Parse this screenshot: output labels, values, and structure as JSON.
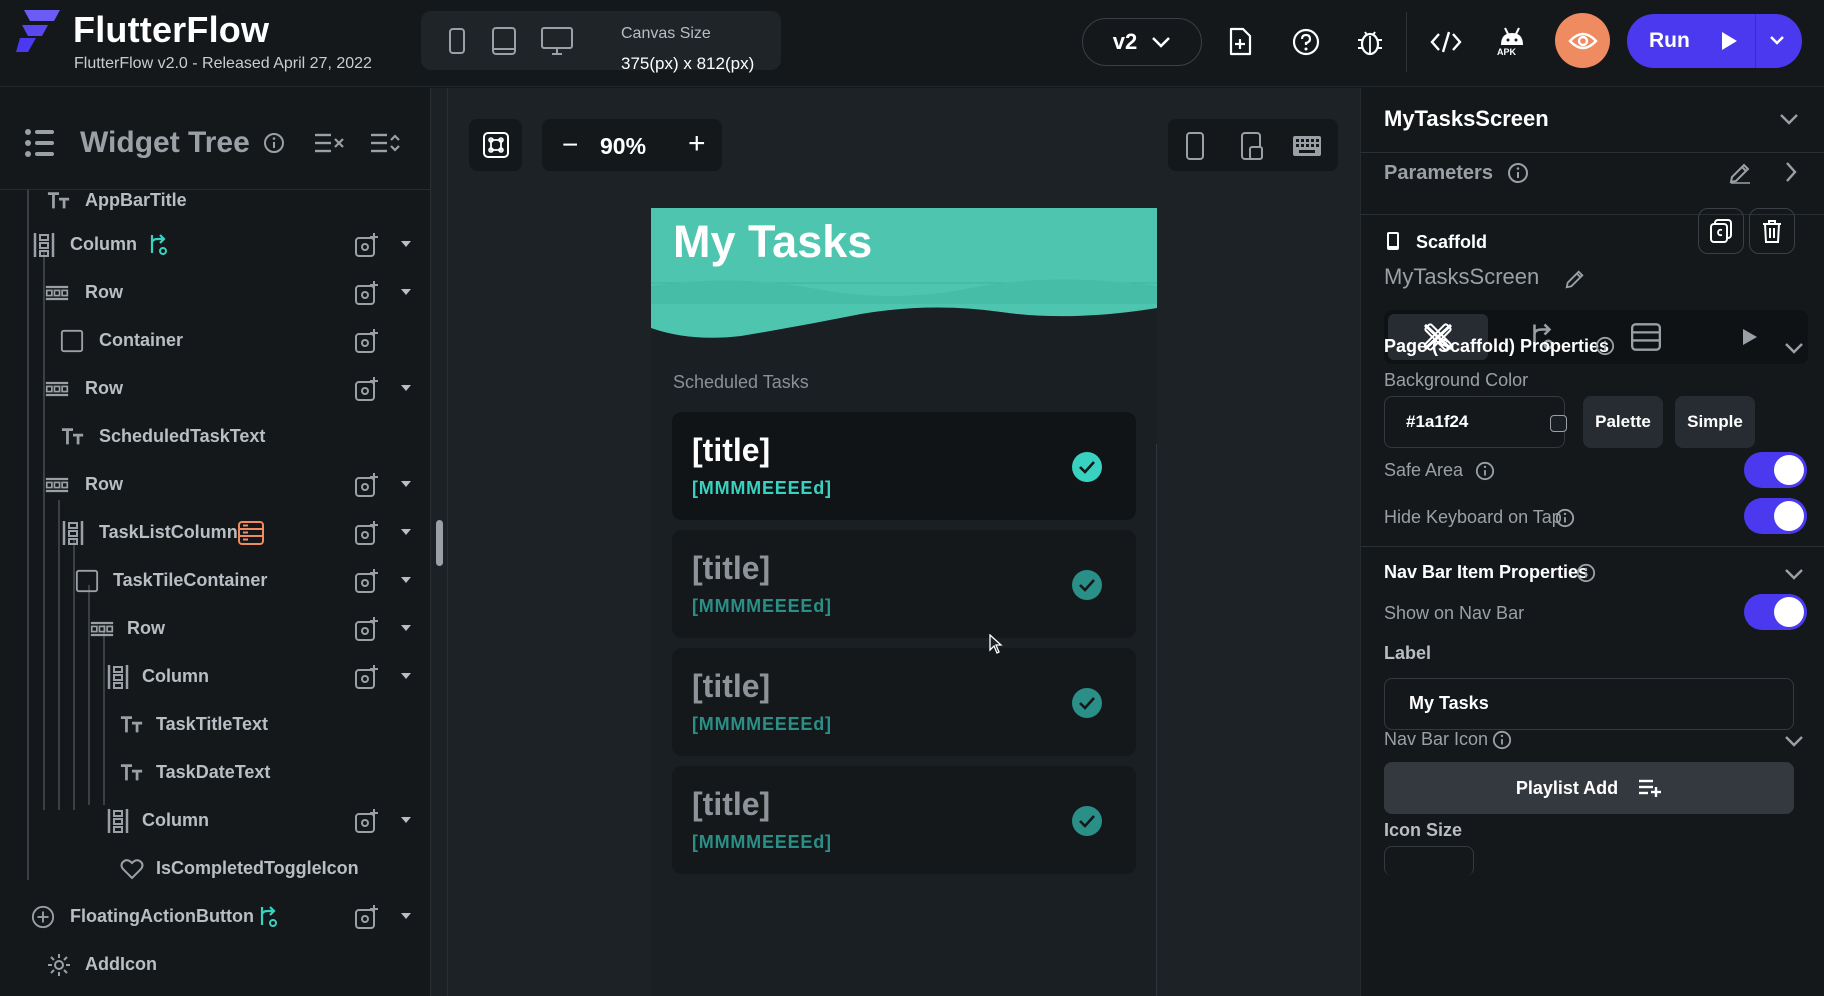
{
  "app": {
    "name": "FlutterFlow",
    "version_text": "FlutterFlow v2.0 - Released April 27, 2022",
    "brand_color": "#4b39ef",
    "accent_color": "#39d2c0"
  },
  "toolbar": {
    "canvas_size_label": "Canvas Size",
    "canvas_size_value": "375(px) x 812(px)",
    "version_select": "v2",
    "apk_label": "APK",
    "run_label": "Run",
    "icons": [
      "phone-icon",
      "tablet-icon",
      "desktop-icon",
      "add-page-icon",
      "help-icon",
      "debug-bug-icon",
      "code-icon",
      "android-apk-icon",
      "preview-eye-icon",
      "play-icon",
      "chevron-down-icon"
    ]
  },
  "widget_tree": {
    "title": "Widget Tree",
    "nodes": [
      {
        "label": "AppBarTitle",
        "icon": "text-icon"
      },
      {
        "label": "Column",
        "icon": "column-icon",
        "badge": "action-flow-icon"
      },
      {
        "label": "Row",
        "icon": "row-icon"
      },
      {
        "label": "Container",
        "icon": "container-icon"
      },
      {
        "label": "Row",
        "icon": "row-icon"
      },
      {
        "label": "ScheduledTaskText",
        "icon": "text-icon"
      },
      {
        "label": "Row",
        "icon": "row-icon"
      },
      {
        "label": "TaskListColumn",
        "icon": "column-icon",
        "badge": "backend-query-icon"
      },
      {
        "label": "TaskTileContainer",
        "icon": "container-icon"
      },
      {
        "label": "Row",
        "icon": "row-icon"
      },
      {
        "label": "Column",
        "icon": "column-icon"
      },
      {
        "label": "TaskTitleText",
        "icon": "text-icon"
      },
      {
        "label": "TaskDateText",
        "icon": "text-icon"
      },
      {
        "label": "Column",
        "icon": "column-icon"
      },
      {
        "label": "IsCompletedToggleIcon",
        "icon": "heart-icon"
      },
      {
        "label": "FloatingActionButton",
        "icon": "plus-circle-icon",
        "badge": "action-flow-icon"
      },
      {
        "label": "AddIcon",
        "icon": "gear-icon"
      }
    ]
  },
  "canvas": {
    "zoom": "90%",
    "zoom_minus": "−",
    "zoom_plus": "+",
    "app_title": "My Tasks",
    "section_label": "Scheduled Tasks",
    "tasks": [
      {
        "title": "[title]",
        "date": "[MMMMEEEEd]"
      },
      {
        "title": "[title]",
        "date": "[MMMMEEEEd]"
      },
      {
        "title": "[title]",
        "date": "[MMMMEEEEd]"
      },
      {
        "title": "[title]",
        "date": "[MMMMEEEEd]"
      }
    ]
  },
  "properties": {
    "page_name": "MyTasksScreen",
    "parameters_label": "Parameters",
    "widget_type": "Scaffold",
    "widget_name": "MyTasksScreen",
    "page_section": "Page (Scaffold) Properties",
    "background_color_label": "Background Color",
    "background_color_value": "#1a1f24",
    "palette_button": "Palette",
    "simple_button": "Simple",
    "safe_area_label": "Safe Area",
    "safe_area_on": true,
    "hide_keyboard_label": "Hide Keyboard on Tap",
    "hide_keyboard_on": true,
    "nav_section": "Nav Bar Item Properties",
    "show_nav_label": "Show on Nav Bar",
    "show_nav_on": true,
    "label_label": "Label",
    "label_value": "My Tasks",
    "nav_icon_label": "Nav Bar Icon",
    "nav_icon_value": "Playlist Add",
    "icon_size_label": "Icon Size"
  }
}
